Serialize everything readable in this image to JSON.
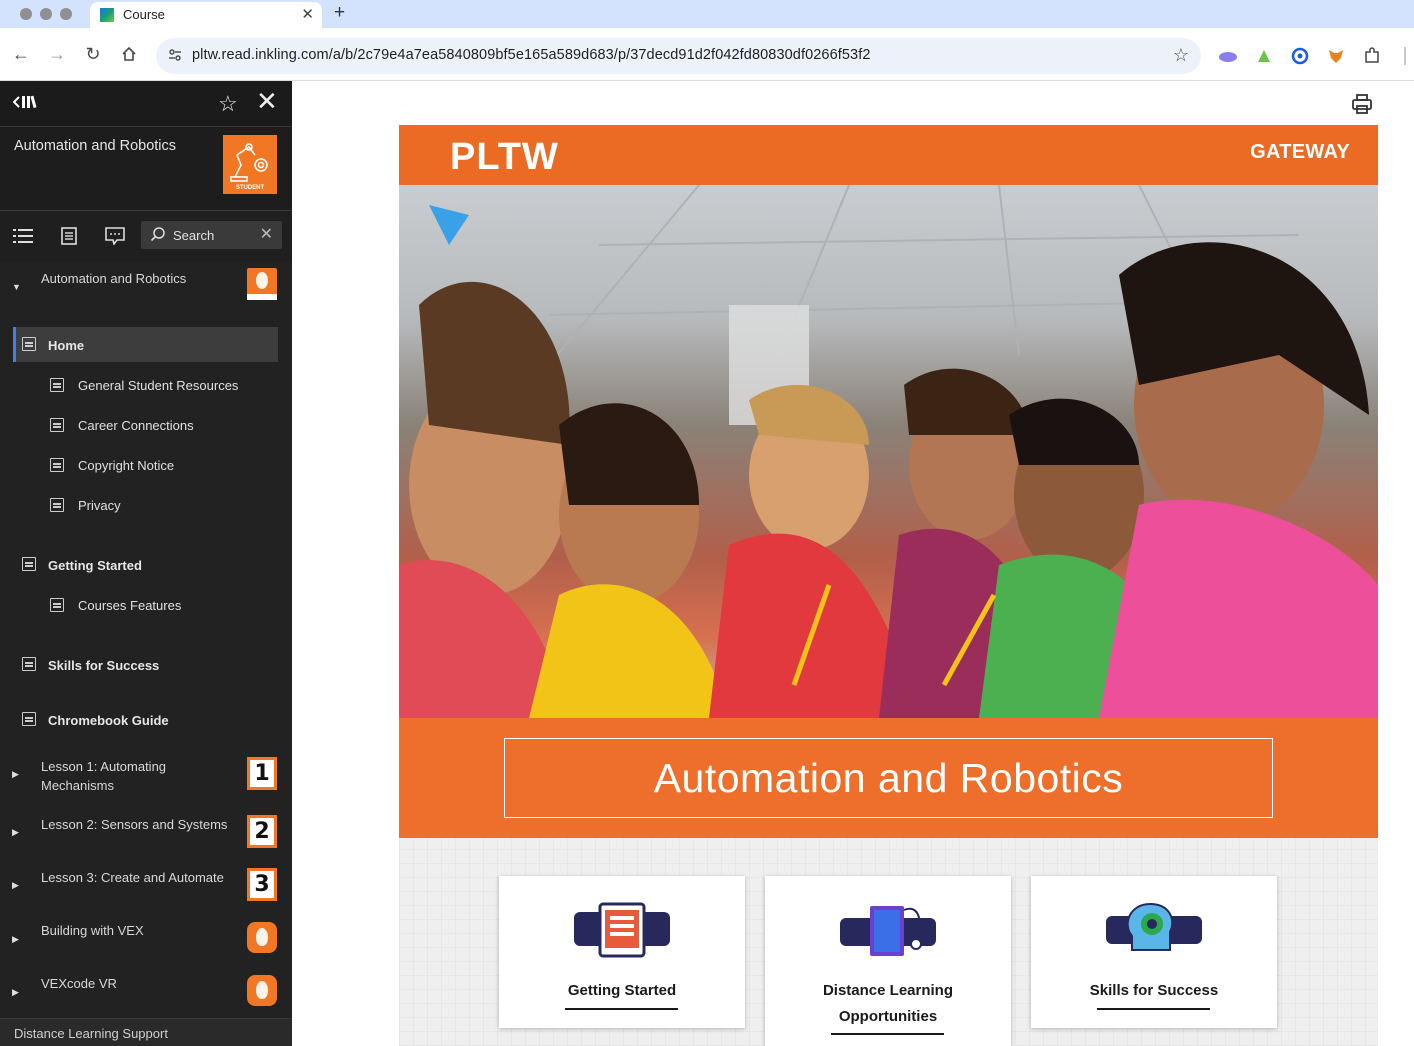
{
  "browser": {
    "tab_title": "Course",
    "url": "pltw.read.inkling.com/a/b/2c79e4a7ea5840809bf5e165a589d683/p/37decd91d2f042fd80830df0266f53f2"
  },
  "sidebar": {
    "course_title": "Automation and Robotics",
    "course_badge_label": "STUDENT",
    "search_placeholder": "Search",
    "chapter_top": "Automation and Robotics",
    "home": "Home",
    "home_children": [
      "General Student Resources",
      "Career Connections",
      "Copyright Notice",
      "Privacy"
    ],
    "getting_started": "Getting Started",
    "getting_started_children": [
      "Courses Features"
    ],
    "skills": "Skills for Success",
    "chromebook": "Chromebook Guide",
    "lessons": [
      {
        "label_line1": "Lesson 1: Automating",
        "label_line2": "Mechanisms",
        "badge": "1"
      },
      {
        "label_line1": "Lesson 2: Sensors and Systems",
        "label_line2": "",
        "badge": "2"
      },
      {
        "label_line1": "Lesson 3: Create and Automate",
        "label_line2": "",
        "badge": "3"
      }
    ],
    "extras": [
      "Building with VEX",
      "VEXcode VR"
    ],
    "footer": "Distance Learning Support"
  },
  "main": {
    "brand": "PLTW",
    "program": "GATEWAY",
    "course_title": "Automation and Robotics",
    "cards": [
      {
        "line1": "Getting Started",
        "line2": ""
      },
      {
        "line1": "Distance Learning",
        "line2": "Opportunities"
      },
      {
        "line1": "Skills for Success",
        "line2": ""
      }
    ]
  },
  "colors": {
    "brand_orange": "#eb6b24",
    "sidebar_bg": "#222222",
    "active_accent": "#3b7ff0"
  }
}
